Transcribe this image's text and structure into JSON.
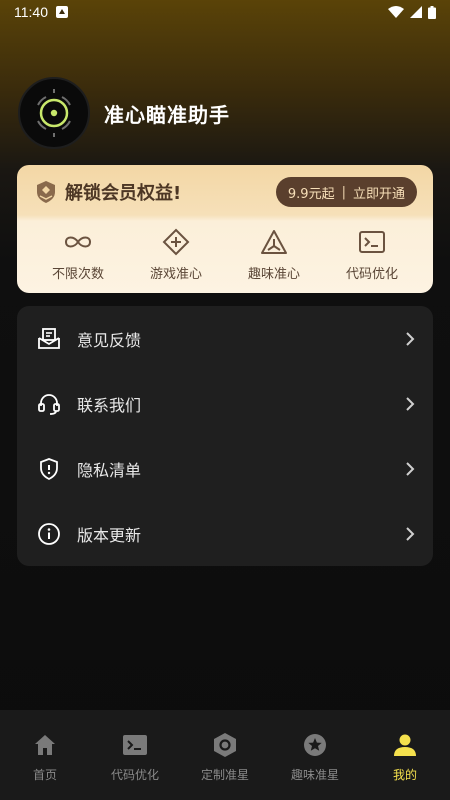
{
  "status_bar": {
    "time": "11:40"
  },
  "profile": {
    "app_name": "准心瞄准助手"
  },
  "vip": {
    "title": "解锁会员权益!",
    "price_label": "9.9元起",
    "action_label": "立即开通",
    "separator": "|",
    "perks": [
      {
        "label": "不限次数",
        "icon": "infinity-icon"
      },
      {
        "label": "游戏准心",
        "icon": "diamond-crosshair-icon"
      },
      {
        "label": "趣味准心",
        "icon": "triangle-crosshair-icon"
      },
      {
        "label": "代码优化",
        "icon": "terminal-icon"
      }
    ],
    "colors": {
      "card_top": "#f3d7a5",
      "card_bottom": "#fdf3e2",
      "button": "#5a3f2d",
      "text": "#4d3725"
    }
  },
  "menu": {
    "items": [
      {
        "label": "意见反馈",
        "icon": "feedback-mail-icon"
      },
      {
        "label": "联系我们",
        "icon": "headset-icon"
      },
      {
        "label": "隐私清单",
        "icon": "shield-icon"
      },
      {
        "label": "版本更新",
        "icon": "info-icon"
      }
    ]
  },
  "bottom_nav": {
    "tabs": [
      {
        "label": "首页",
        "icon": "home-icon",
        "active": false
      },
      {
        "label": "代码优化",
        "icon": "terminal-icon",
        "active": false
      },
      {
        "label": "定制准星",
        "icon": "hexagon-icon",
        "active": false
      },
      {
        "label": "趣味准星",
        "icon": "star-badge-icon",
        "active": false
      },
      {
        "label": "我的",
        "icon": "person-icon",
        "active": true
      }
    ],
    "active_color": "#f4e04d",
    "inactive_color": "#8a8a8a"
  }
}
